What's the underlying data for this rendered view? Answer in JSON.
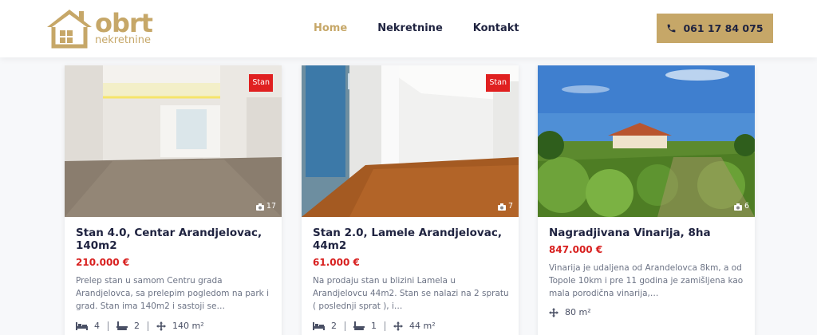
{
  "brand": {
    "name": "obrt",
    "subtitle": "nekretnine",
    "color": "#c6a768"
  },
  "nav": [
    {
      "label": "Home",
      "active": true
    },
    {
      "label": "Nekretnine",
      "active": false
    },
    {
      "label": "Kontakt",
      "active": false
    }
  ],
  "phone": {
    "icon": "phone-icon",
    "number": "061 17 84 075"
  },
  "listings": [
    {
      "tag": "Stan",
      "photo_count": "17",
      "title": "Stan 4.0, Centar Arandjelovac, 140m2",
      "price": "210.000 €",
      "description": "Prelep stan u samom Centru grada Arandjelovca, sa prelepim pogledom na park i grad. Stan ima 140m2 i sastoji se…",
      "beds": "4",
      "baths": "2",
      "area": "140 m²"
    },
    {
      "tag": "Stan",
      "photo_count": "7",
      "title": "Stan 2.0, Lamele Arandjelovac, 44m2",
      "price": "61.000 €",
      "description": "Na prodaju stan u blizini Lamela u Arandjelovcu 44m2. Stan se nalazi na 2 spratu ( poslednji sprat ), i…",
      "beds": "2",
      "baths": "1",
      "area": "44 m²"
    },
    {
      "photo_count": "6",
      "title": "Nagradjivana Vinarija, 8ha",
      "price": "847.000 €",
      "description": "Vinarija je udaljena od Arandelovca 8km, a od Topole 10km i pre 11 godina je zamišljena kao mala porodična vinarija,…",
      "area": "80 m²"
    }
  ],
  "colors": {
    "accent": "#c6a768",
    "price": "#d8201f",
    "tag": "#e02020",
    "text": "#1f2340"
  }
}
